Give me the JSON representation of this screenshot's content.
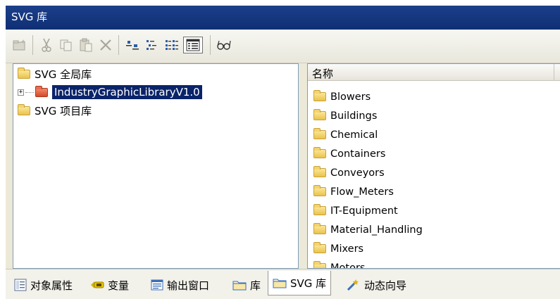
{
  "window": {
    "title": "SVG 库"
  },
  "toolbar": {
    "buttons": [
      {
        "icon": "new-folder-icon"
      },
      {
        "icon": "cut-icon"
      },
      {
        "icon": "copy-icon"
      },
      {
        "icon": "paste-icon"
      },
      {
        "icon": "delete-icon"
      },
      {
        "icon": "large-icons-view-icon"
      },
      {
        "icon": "small-icons-view-icon"
      },
      {
        "icon": "list-view-icon"
      },
      {
        "icon": "details-view-icon",
        "active": true
      },
      {
        "icon": "preview-glasses-icon"
      }
    ]
  },
  "tree": {
    "items": [
      {
        "label": "SVG 全局库"
      },
      {
        "label": "IndustryGraphicLibraryV1.0",
        "selected": true,
        "expander": "+"
      },
      {
        "label": "SVG 项目库"
      }
    ]
  },
  "list": {
    "column_header": "名称",
    "items": [
      "Blowers",
      "Buildings",
      "Chemical",
      "Containers",
      "Conveyors",
      "Flow_Meters",
      "IT-Equipment",
      "Material_Handling",
      "Mixers",
      "Motors"
    ]
  },
  "tabs": [
    {
      "label": "对象属性",
      "icon": "properties-icon"
    },
    {
      "label": "变量",
      "icon": "variable-icon"
    },
    {
      "label": "输出窗口",
      "icon": "output-window-icon"
    },
    {
      "label": "库",
      "icon": "library-folder-icon"
    },
    {
      "label": "SVG 库",
      "icon": "svg-library-folder-icon",
      "active": true
    },
    {
      "label": "动态向导",
      "icon": "dynamic-wizard-icon"
    }
  ],
  "colors": {
    "title_bar": "#0f2f74",
    "selection": "#0a246a",
    "folder": "#ebc24a",
    "library_folder": "#d44a2b"
  }
}
